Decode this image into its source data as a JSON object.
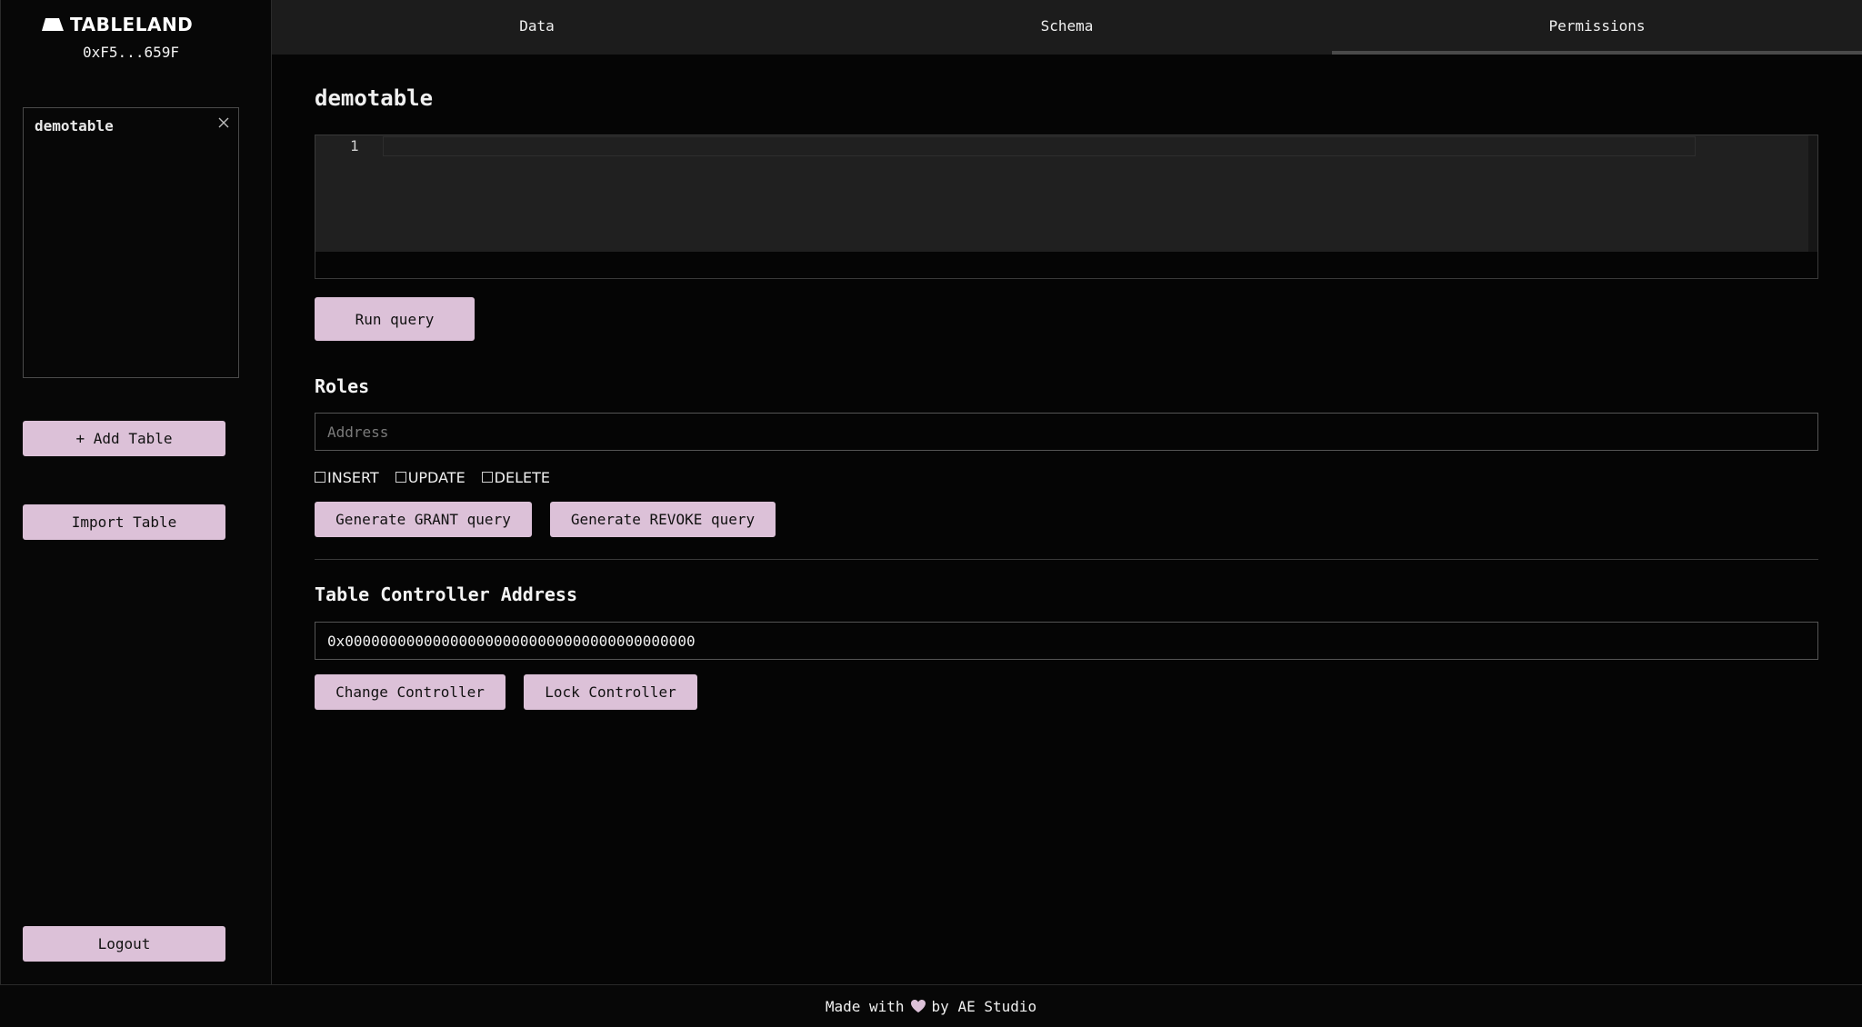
{
  "brand": {
    "name": "TABLELAND",
    "logo_icon": "tableland-logo-icon"
  },
  "wallet": {
    "address": "0xF5...659F"
  },
  "sidebar": {
    "tables": [
      {
        "name": "demotable"
      }
    ],
    "add_table_label": "+ Add Table",
    "import_table_label": "Import Table",
    "logout_label": "Logout"
  },
  "tabs": [
    {
      "label": "Data",
      "active": false
    },
    {
      "label": "Schema",
      "active": false
    },
    {
      "label": "Permissions",
      "active": true
    }
  ],
  "main": {
    "table_title": "demotable",
    "editor": {
      "line_number": "1",
      "content": ""
    },
    "run_query_label": "Run query",
    "roles": {
      "title": "Roles",
      "address_placeholder": "Address",
      "address_value": "",
      "permissions": [
        {
          "label": "INSERT",
          "checked": false
        },
        {
          "label": "UPDATE",
          "checked": false
        },
        {
          "label": "DELETE",
          "checked": false
        }
      ],
      "grant_label": "Generate GRANT query",
      "revoke_label": "Generate REVOKE query"
    },
    "controller": {
      "title": "Table Controller Address",
      "address_value": "0x0000000000000000000000000000000000000000",
      "change_label": "Change Controller",
      "lock_label": "Lock Controller"
    }
  },
  "footer": {
    "prefix": "Made with",
    "suffix": "by AE Studio",
    "heart_color": "#dcc1d8"
  },
  "colors": {
    "accent": "#dcc1d8",
    "background": "#050505",
    "tab_bar": "#1c1c1c"
  }
}
